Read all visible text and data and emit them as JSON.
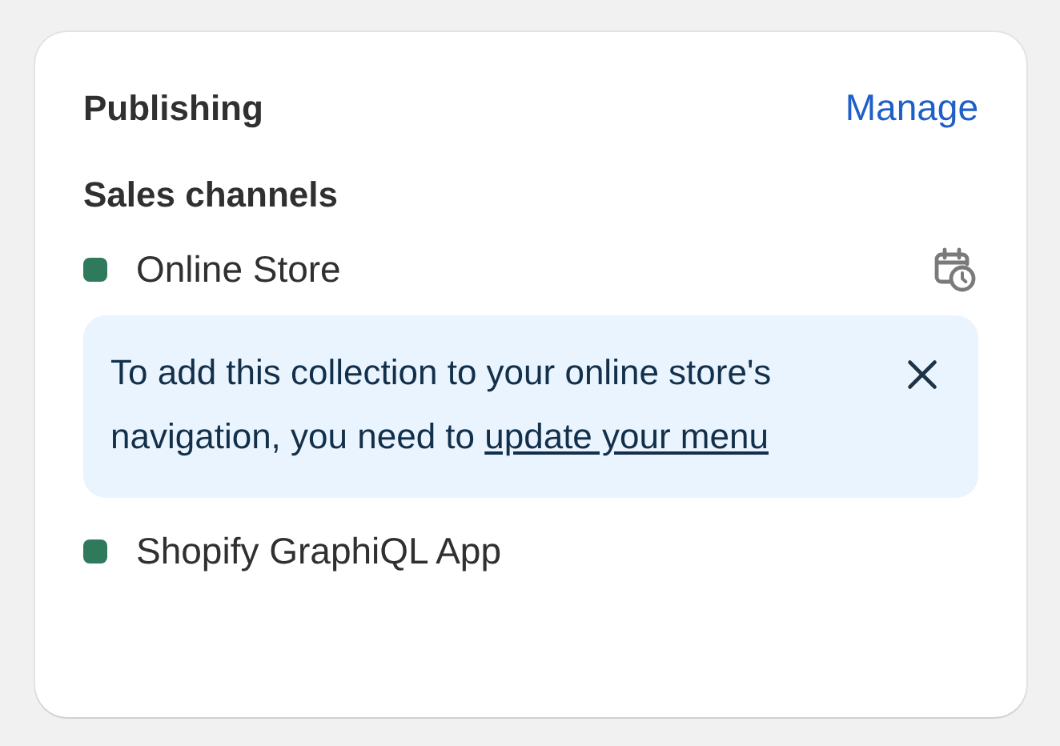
{
  "card": {
    "title": "Publishing",
    "action": "Manage"
  },
  "section": {
    "title": "Sales channels"
  },
  "channels": [
    {
      "name": "Online Store",
      "color": "#2f7a5c",
      "scheduled": true,
      "banner": {
        "text": "To add this collection to your online store's navigation, you need to",
        "link": "update your menu",
        "dismissible": true
      }
    },
    {
      "name": "Shopify GraphiQL App",
      "color": "#2f7a5c",
      "scheduled": false
    }
  ]
}
